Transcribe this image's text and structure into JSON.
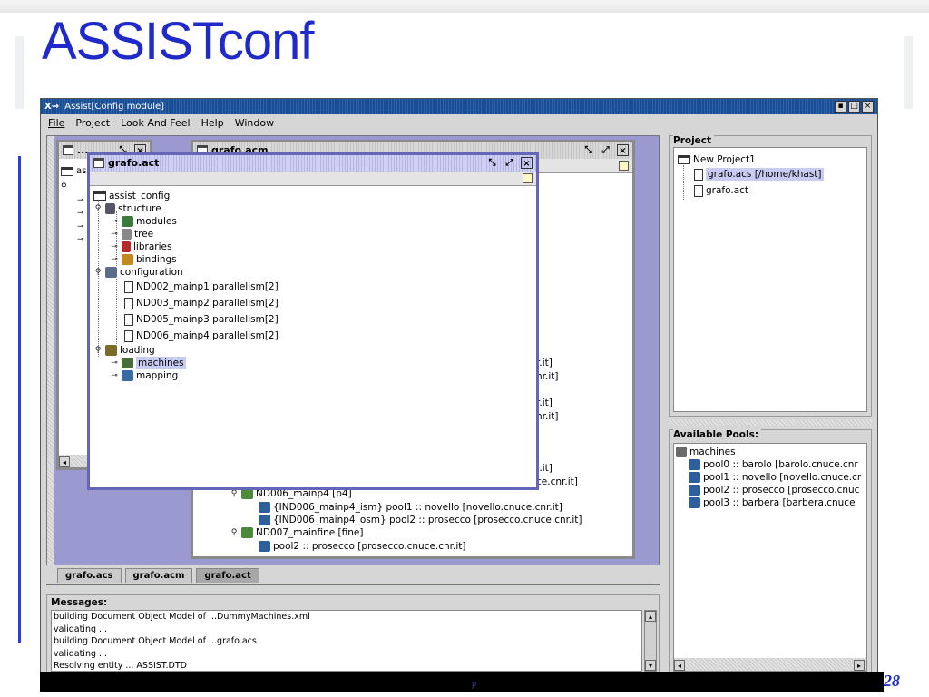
{
  "slide": {
    "title": "ASSISTconf",
    "page_number": "28",
    "footer_fragment": "p"
  },
  "app": {
    "title": "Assist[Config module]",
    "menu": [
      "File",
      "Project",
      "Look And Feel",
      "Help",
      "Window"
    ],
    "buttons": [
      "▪",
      "□",
      "×"
    ]
  },
  "back_frame": {
    "title": "...",
    "tree_root": "assi"
  },
  "acm_frame": {
    "title": "grafo.acm",
    "visible_rows": [
      "r.it]",
      "nr.it]",
      "r.it]",
      "nr.it]",
      "r.it]",
      "ce.cnr.it]"
    ],
    "tree": [
      {
        "indent": 0,
        "handle": "⚲",
        "label": "ND006_mainp4 [p4]"
      },
      {
        "indent": 1,
        "handle": "",
        "label": "{IND006_mainp4_ism} pool1 :: novello  [novello.cnuce.cnr.it]"
      },
      {
        "indent": 1,
        "handle": "",
        "label": "{IND006_mainp4_osm} pool2 :: prosecco  [prosecco.cnuce.cnr.it]"
      },
      {
        "indent": 0,
        "handle": "⚲",
        "label": "ND007_mainfine [fine]"
      },
      {
        "indent": 1,
        "handle": "",
        "label": "pool2 :: prosecco  [prosecco.cnuce.cnr.it]"
      }
    ]
  },
  "act_frame": {
    "title": "grafo.act",
    "tree": [
      {
        "label": "assist_config",
        "icon": "folder",
        "handle": ""
      },
      {
        "label": "structure",
        "icon": "struct",
        "handle": "⚲"
      },
      {
        "label": "modules",
        "icon": "modules",
        "handle": "⊸"
      },
      {
        "label": "tree",
        "icon": "tree",
        "handle": "⊸"
      },
      {
        "label": "libraries",
        "icon": "libraries",
        "handle": "⊸"
      },
      {
        "label": "bindings",
        "icon": "bindings",
        "handle": "⊸"
      },
      {
        "label": "configuration",
        "icon": "config",
        "handle": "⚲"
      },
      {
        "label": "ND002_mainp1  parallelism[2]",
        "icon": "doc",
        "handle": ""
      },
      {
        "label": "ND003_mainp2  parallelism[2]",
        "icon": "doc",
        "handle": ""
      },
      {
        "label": "ND005_mainp3  parallelism[2]",
        "icon": "doc",
        "handle": ""
      },
      {
        "label": "ND006_mainp4  parallelism[2]",
        "icon": "doc",
        "handle": ""
      },
      {
        "label": "loading",
        "icon": "loading",
        "handle": "⚲"
      },
      {
        "label": "machines",
        "icon": "machines",
        "handle": "⊸"
      },
      {
        "label": "mapping",
        "icon": "mapping",
        "handle": "⊸"
      }
    ]
  },
  "project_panel": {
    "title": "Project",
    "items": [
      {
        "label": "New Project1",
        "kind": "folder"
      },
      {
        "label": "grafo.acs [/home/khast]",
        "kind": "doc",
        "selected": true
      },
      {
        "label": "grafo.act",
        "kind": "doc",
        "selected": false
      }
    ]
  },
  "pools_panel": {
    "title": "Available Pools:",
    "root": "machines",
    "items": [
      "pool0 :: barolo  [barolo.cnuce.cnr",
      "pool1 :: novello  [novello.cnuce.cr",
      "pool2 :: prosecco  [prosecco.cnuc",
      "pool3 :: barbera  [barbera.cnuce"
    ]
  },
  "tabs": [
    "grafo.acs",
    "grafo.acm",
    "grafo.act"
  ],
  "messages": {
    "title": "Messages:",
    "lines": [
      "building Document Object Model of ...DummyMachines.xml",
      "validating ...",
      "building Document Object Model of ...grafo.acs",
      "validating ...",
      "Resolving entity ... ASSIST.DTD"
    ]
  },
  "colors": {
    "title_blue": "#1f2ac8",
    "desktop": "#9a9ad0",
    "titlebar": "#2a62ad",
    "selection": "#c8ccf2"
  }
}
